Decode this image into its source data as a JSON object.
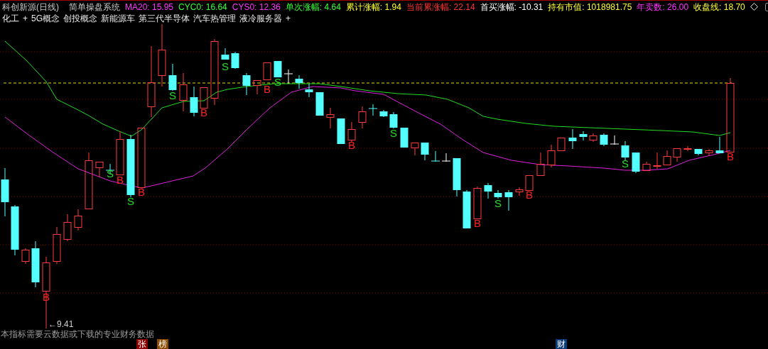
{
  "header": {
    "stock": "科创新源(日线)",
    "system": "简单操盘系统",
    "indicators": [
      {
        "label": "MA20:",
        "value": "15.95",
        "color": "#ff33ff"
      },
      {
        "label": "CYC0:",
        "value": "16.64",
        "color": "#33ff33"
      },
      {
        "label": "CYS0:",
        "value": "12.36",
        "color": "#ff33ff"
      },
      {
        "label": "单次涨幅:",
        "value": "4.64",
        "color": "#33ff33"
      },
      {
        "label": "累计涨幅:",
        "value": "1.94",
        "color": "#ffff33"
      },
      {
        "label": "当前累涨幅:",
        "value": "22.14",
        "color": "#ff3333"
      },
      {
        "label": "首买涨幅:",
        "value": "-10.31",
        "color": "#ffffff"
      },
      {
        "label": "持有市值:",
        "value": "1018981.75",
        "color": "#ffff33"
      },
      {
        "label": "年卖数:",
        "value": "26.00",
        "color": "#ff33ff"
      },
      {
        "label": "收盘线:",
        "value": "18.70",
        "color": "#ffff33"
      }
    ]
  },
  "concepts": [
    {
      "text": "化工",
      "add": "+"
    },
    {
      "text": "5G概念"
    },
    {
      "text": "创投概念"
    },
    {
      "text": "新能源车"
    },
    {
      "text": "第三代半导体"
    },
    {
      "text": "汽车热管理"
    },
    {
      "text": "液冷服务器",
      "add": "+"
    }
  ],
  "chart": {
    "low_label": "←9.41",
    "signals": [
      {
        "kind": "buy",
        "text": "B"
      },
      {
        "kind": "sell",
        "text": "S"
      },
      {
        "kind": "buy",
        "text": "B"
      },
      {
        "kind": "sell",
        "text": "S"
      },
      {
        "kind": "buy",
        "text": "B"
      },
      {
        "kind": "sell",
        "text": "S"
      },
      {
        "kind": "buy",
        "text": "B"
      },
      {
        "kind": "sell",
        "text": "S"
      },
      {
        "kind": "buy",
        "text": "B"
      },
      {
        "kind": "sell",
        "text": "S"
      },
      {
        "kind": "buy",
        "text": "B"
      },
      {
        "kind": "sell",
        "text": "S"
      },
      {
        "kind": "buy",
        "text": "B"
      },
      {
        "kind": "sell",
        "text": "S"
      },
      {
        "kind": "buy",
        "text": "B"
      },
      {
        "kind": "sell",
        "text": "S"
      },
      {
        "kind": "buy",
        "text": "B"
      }
    ]
  },
  "notice": "本指标需要云数据或下载的专业财务数据",
  "footer_badges": [
    {
      "text": "张",
      "color": "#8b0000"
    },
    {
      "text": "榜",
      "color": "#8b4a00"
    },
    {
      "text": "财",
      "color": "#0b3a78"
    }
  ]
}
